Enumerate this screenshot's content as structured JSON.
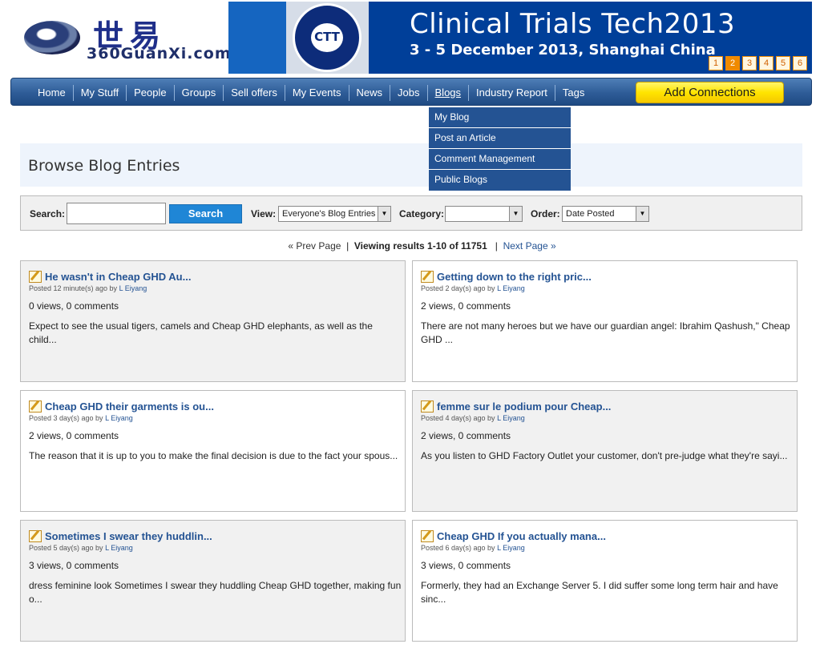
{
  "header": {
    "logo_cn": "世易",
    "logo_site": "360GuanXi.com",
    "banner": {
      "seal_text": "CTT",
      "title": "Clinical Trials Tech2013",
      "subtitle": "3 - 5 December 2013, Shanghai China",
      "pages": [
        "1",
        "2",
        "3",
        "4",
        "5",
        "6"
      ]
    }
  },
  "nav": {
    "items": [
      "Home",
      "My Stuff",
      "People",
      "Groups",
      "Sell offers",
      "My Events",
      "News",
      "Jobs",
      "Blogs",
      "Industry Report",
      "Tags"
    ],
    "add_connections": "Add Connections"
  },
  "blogs_menu": [
    "My Blog",
    "Post an Article",
    "Comment Management",
    "Public Blogs"
  ],
  "page_title": "Browse Blog Entries",
  "search": {
    "label": "Search:",
    "value": "",
    "button": "Search",
    "view_label": "View:",
    "view_value": "Everyone's Blog Entries",
    "category_label": "Category:",
    "category_value": "",
    "order_label": "Order:",
    "order_value": "Date Posted"
  },
  "pager": {
    "prev": "« Prev Page",
    "sep": "|",
    "viewing": "Viewing results 1-10 of 11751",
    "next": "Next Page »"
  },
  "entries": [
    {
      "title": "He wasn't in Cheap GHD Au...",
      "posted": "Posted 12 minute(s) ago by",
      "author": "L Eiyang",
      "stats": "0 views, 0 comments",
      "excerpt": "Expect to see the usual tigers, camels and Cheap GHD elephants, as well as the child..."
    },
    {
      "title": "Getting down to the right pric...",
      "posted": "Posted 2 day(s) ago by",
      "author": "L Eiyang",
      "stats": "2 views, 0 comments",
      "excerpt": "There are not many heroes but we have our guardian angel: Ibrahim Qashush,\" Cheap GHD ..."
    },
    {
      "title": "Cheap GHD their garments is ou...",
      "posted": "Posted 3 day(s) ago by",
      "author": "L Eiyang",
      "stats": "2 views, 0 comments",
      "excerpt": "The reason that it is up to you to make the final decision is due to the fact your spous..."
    },
    {
      "title": "femme sur le podium pour Cheap...",
      "posted": "Posted 4 day(s) ago by",
      "author": "L Eiyang",
      "stats": "2 views, 0 comments",
      "excerpt": "As you listen to GHD Factory Outlet your customer, don't pre-judge what they're sayi..."
    },
    {
      "title": "Sometimes I swear they huddlin...",
      "posted": "Posted 5 day(s) ago by",
      "author": "L Eiyang",
      "stats": "3 views, 0 comments",
      "excerpt": "dress feminine look Sometimes I swear they huddling Cheap GHD together, making fun o..."
    },
    {
      "title": "Cheap GHD If you actually mana...",
      "posted": "Posted 6 day(s) ago by",
      "author": "L Eiyang",
      "stats": "3 views, 0 comments",
      "excerpt": "Formerly, they had an Exchange Server 5. I did suffer some long term hair and have sinc..."
    }
  ]
}
